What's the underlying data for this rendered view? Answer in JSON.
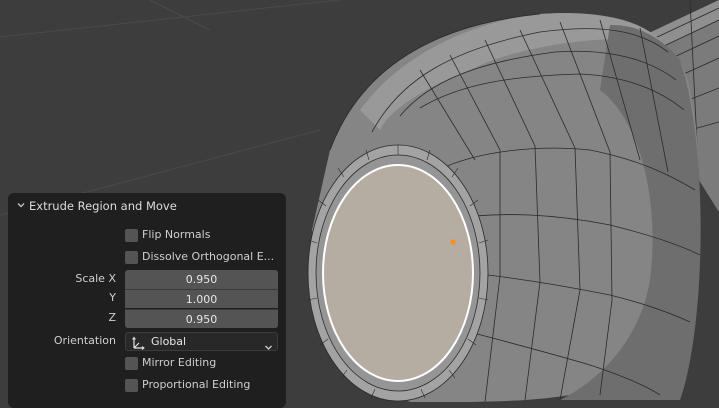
{
  "operator_panel": {
    "title": "Extrude Region and Move",
    "flip_normals": {
      "label": "Flip Normals",
      "checked": false
    },
    "dissolve_orthogonal": {
      "label": "Dissolve Orthogonal E...",
      "checked": false
    },
    "scale": {
      "x_label": "Scale X",
      "x_value": "0.950",
      "y_label": "Y",
      "y_value": "1.000",
      "z_label": "Z",
      "z_value": "0.950"
    },
    "orientation": {
      "label": "Orientation",
      "value": "Global",
      "icon": "orientation-axes-icon"
    },
    "mirror_editing": {
      "label": "Mirror Editing",
      "checked": false
    },
    "proportional_editing": {
      "label": "Proportional Editing",
      "checked": false
    }
  },
  "colors": {
    "viewport_bg": "#3d3d3d",
    "panel_bg": "#1f1f1f",
    "field_bg": "#545454",
    "mesh_face": "#8a8a8a",
    "selected_face": "#b5aca2",
    "selected_edge": "#ffffff",
    "active_vertex": "#ff8c1a"
  }
}
